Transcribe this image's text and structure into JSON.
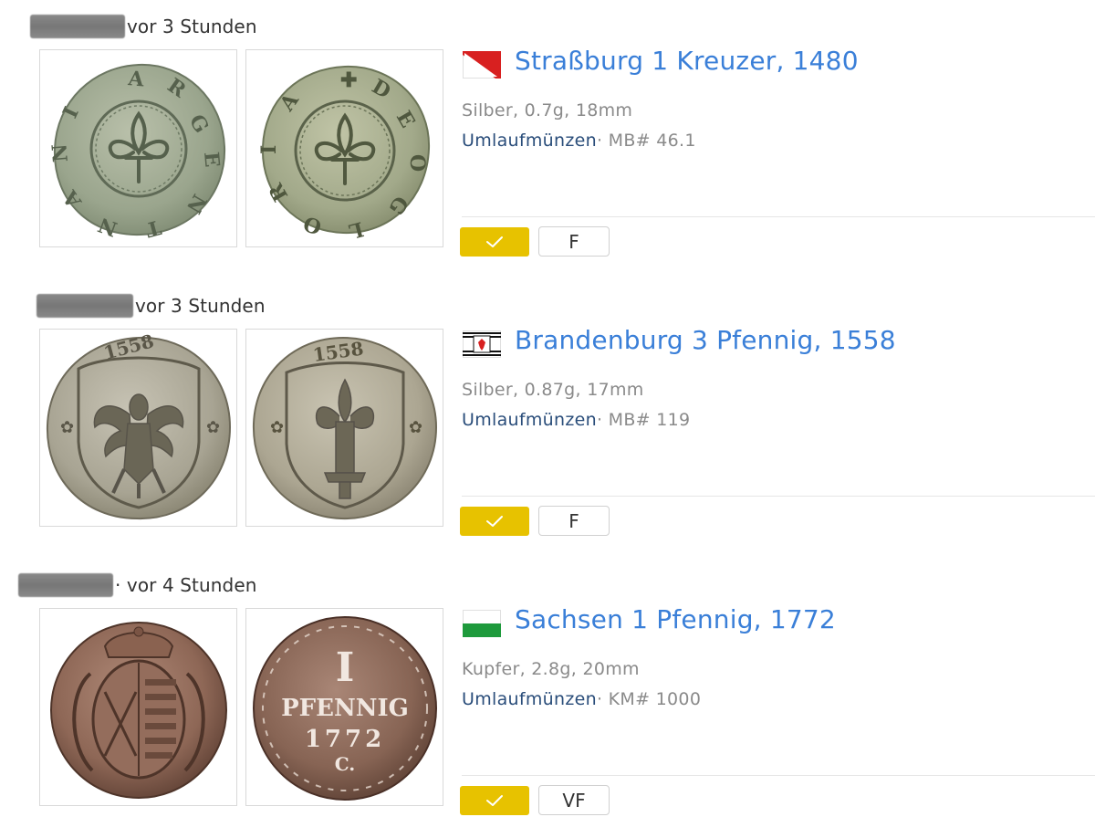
{
  "entries": [
    {
      "time": "vor 3 Stunden",
      "title": "Straßburg 1 Kreuzer, 1480",
      "specs": "Silber, 0.7g, 18mm",
      "category": "Umlaufmünzen",
      "catalog": "· MB# 46.1",
      "grade": "F",
      "check_icon": "check-icon",
      "flag_colors": [
        "#d82020",
        "#ffffff"
      ],
      "obverse_legend": "ARG NTINA",
      "reverse_legend": "DEO GLORIA"
    },
    {
      "time": "vor 3 Stunden",
      "title": "Brandenburg 3 Pfennig, 1558",
      "specs": "Silber, 0.87g, 17mm",
      "category": "Umlaufmünzen",
      "catalog": "· MB# 119",
      "grade": "F",
      "check_icon": "check-icon",
      "flag_colors": [
        "#ffffff",
        "#111111",
        "#d82020"
      ],
      "obverse_legend": "1558",
      "reverse_legend": "1558"
    },
    {
      "time": "· vor 4 Stunden",
      "title": "Sachsen 1 Pfennig, 1772",
      "specs": "Kupfer, 2.8g, 20mm",
      "category": "Umlaufmünzen",
      "catalog": "· KM# 1000",
      "grade": "VF",
      "check_icon": "check-icon",
      "flag_colors": [
        "#ffffff",
        "#1e9a3c"
      ],
      "reverse_value": "I",
      "reverse_unit": "PFENNIG",
      "reverse_year": "1772",
      "reverse_mint": "C."
    }
  ],
  "colors": {
    "title": "#3a7fd8",
    "check_button": "#e7c200",
    "category_link": "#2a4d7a",
    "muted_text": "#8a8a8a"
  }
}
